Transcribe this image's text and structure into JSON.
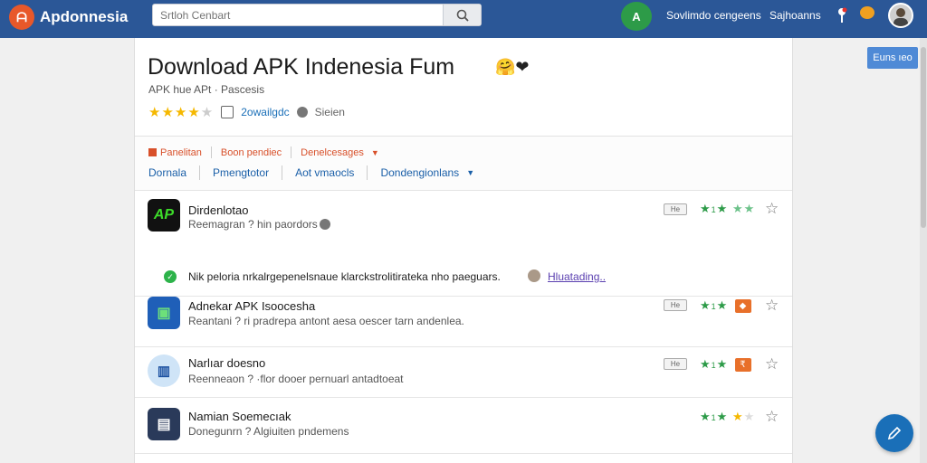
{
  "header": {
    "logo_text": "ᗩ",
    "brand": "Apdonnesia",
    "search_placeholder": "Srtloh Cenbart",
    "nav_circle_text": "A",
    "nav_link_1": "Sovlimdo cengeens",
    "nav_link_2": "Sajhoanns",
    "accent": "#2b5797"
  },
  "side_button": "Euns ıeo",
  "page": {
    "title": "Download APK Indenesia Fum",
    "emoji": "🤗❤",
    "subtitle": "APK hue APt · Pascesis",
    "rating_stars": 4,
    "rating_link": "2owailgdc",
    "rating_extra": "Sieien"
  },
  "filters": {
    "row1": [
      "Panelitan",
      "Boon pendiec",
      "Denelcesages"
    ],
    "row2": [
      "Dornala",
      "Pmengtotor",
      "Aot vmaocls",
      "Dondengionlans"
    ]
  },
  "apps": [
    {
      "name": "Dirdenlotao",
      "desc": "Reemagran ? hin paordors",
      "icon_text": "AP",
      "badge": "He",
      "rating_color": "#2d9b48"
    },
    {
      "name": "Adnekar APK Isoocesha",
      "desc": "Reantani ? ri pradrepa antont aesa oescer tarn andenlea.",
      "icon_text": "▣",
      "badge": "He",
      "tag": "◆"
    },
    {
      "name": "Narlıar doesno",
      "desc": "Reenneaon ? ·flor dooer pernuarl antadtoeat",
      "icon_text": "▥",
      "badge": "He",
      "tag": "₹"
    },
    {
      "name": "Namian Soemecıak",
      "desc": "Donegunrn ? Algiuiten pndemens",
      "icon_text": "▤"
    }
  ],
  "note": {
    "text": "Nik peloria nrkalrgepenelsnaue klarckstrolitirateka nho paeguars.",
    "link": "Hluatading.."
  }
}
